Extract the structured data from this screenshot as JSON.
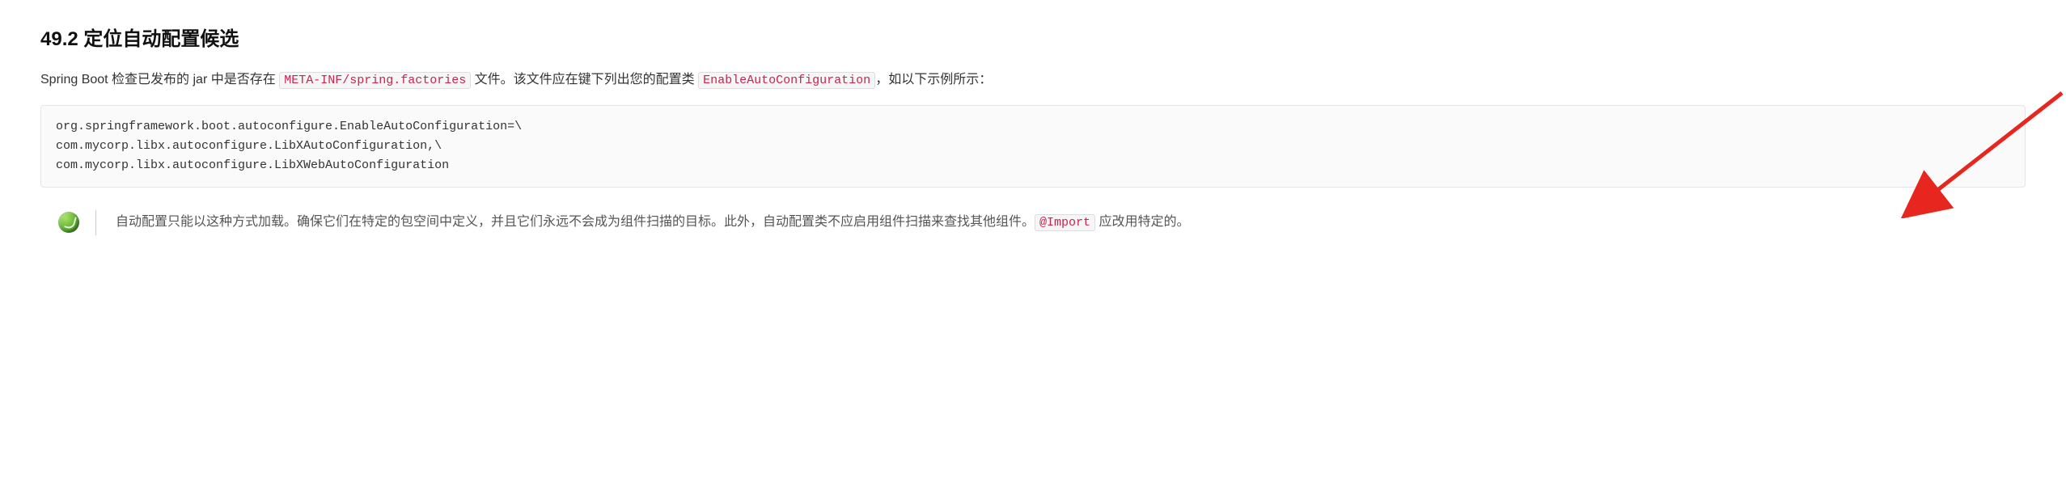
{
  "heading": "49.2 定位自动配置候选",
  "para1_part1": "Spring Boot 检查已发布的 jar 中是否存在 ",
  "para1_code1": "META-INF/spring.factories",
  "para1_part2": " 文件。该文件应在键下列出您的配置类 ",
  "para1_code2": "EnableAutoConfiguration",
  "para1_part3": "，如以下示例所示：",
  "code_block": "org.springframework.boot.autoconfigure.EnableAutoConfiguration=\\\ncom.mycorp.libx.autoconfigure.LibXAutoConfiguration,\\\ncom.mycorp.libx.autoconfigure.LibXWebAutoConfiguration",
  "note_part1": "自动配置只能以这种方式加载。确保它们在特定的包空间中定义，并且它们永远不会成为组件扫描的目标。此外，自动配置类不应启用组件扫描来查找其他组件。",
  "note_code": "@Import",
  "note_part2": " 应改用特定的。"
}
